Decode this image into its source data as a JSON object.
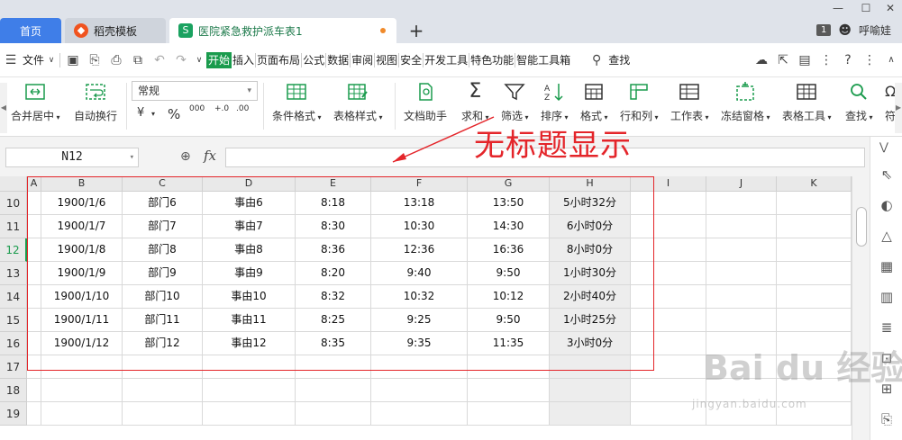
{
  "titlebar": {
    "tabs": [
      {
        "label": "首页",
        "icon": "home-tab"
      },
      {
        "label": "稻壳模板",
        "icon": "docer-icon"
      },
      {
        "label": "医院紧急救护派车表1",
        "icon": "spreadsheet-icon",
        "status": "unsaved-dot"
      }
    ],
    "new_tab": "+",
    "page_count": "1",
    "user_name": "呼喻娃"
  },
  "menubar": {
    "file_label": "文件",
    "items": [
      "开始",
      "插入",
      "页面布局",
      "公式",
      "数据",
      "审阅",
      "视图",
      "安全",
      "开发工具",
      "特色功能",
      "智能工具箱"
    ],
    "active": "开始",
    "search_label": "查找",
    "help": "?"
  },
  "ribbon": {
    "buttons": {
      "merge_center": "合并居中",
      "wrap_text": "自动换行",
      "cond_format": "条件格式",
      "table_style": "表格样式",
      "doc_helper": "文档助手",
      "sum": "求和",
      "filter": "筛选",
      "sort": "排序",
      "format": "格式",
      "row_col": "行和列",
      "worksheet": "工作表",
      "freeze": "冻结窗格",
      "table_tools": "表格工具",
      "find": "查找",
      "symbol": "符"
    },
    "number_format": "常规",
    "small_tools": [
      "¥",
      "%",
      "000",
      "+.0",
      ".00"
    ]
  },
  "formula_bar": {
    "name_box": "N12",
    "fx_label": "fx",
    "formula": ""
  },
  "sheet": {
    "columns": [
      "A",
      "B",
      "C",
      "D",
      "E",
      "F",
      "G",
      "H",
      "I",
      "J",
      "K"
    ],
    "row_numbers": [
      "10",
      "11",
      "12",
      "13",
      "14",
      "15",
      "16",
      "17",
      "18",
      "19"
    ],
    "selected_row": "12",
    "rows": [
      [
        "",
        "1900/1/6",
        "部门6",
        "事由6",
        "8:18",
        "13:18",
        "13:50",
        "5小时32分"
      ],
      [
        "",
        "1900/1/7",
        "部门7",
        "事由7",
        "8:30",
        "10:30",
        "14:30",
        "6小时0分"
      ],
      [
        "",
        "1900/1/8",
        "部门8",
        "事由8",
        "8:36",
        "12:36",
        "16:36",
        "8小时0分"
      ],
      [
        "",
        "1900/1/9",
        "部门9",
        "事由9",
        "8:20",
        "9:40",
        "9:50",
        "1小时30分"
      ],
      [
        "",
        "1900/1/10",
        "部门10",
        "事由10",
        "8:32",
        "10:32",
        "10:12",
        "2小时40分"
      ],
      [
        "",
        "1900/1/11",
        "部门11",
        "事由11",
        "8:25",
        "9:25",
        "9:50",
        "1小时25分"
      ],
      [
        "",
        "1900/1/12",
        "部门12",
        "事由12",
        "8:35",
        "9:35",
        "11:35",
        "3小时0分"
      ],
      [
        "",
        "",
        "",
        "",
        "",
        "",
        "",
        ""
      ],
      [
        "",
        "",
        "",
        "",
        "",
        "",
        "",
        ""
      ],
      [
        "",
        "",
        "",
        "",
        "",
        "",
        "",
        ""
      ]
    ]
  },
  "annotation": {
    "text": "无标题显示",
    "color": "#e4252a"
  },
  "watermark": {
    "text": "Bai du 经验",
    "subtext": "jingyan.baidu.com"
  },
  "colors": {
    "accent_green": "#1a9b4d",
    "home_tab_blue": "#3f7ee8",
    "annotation_red": "#e4252a"
  }
}
